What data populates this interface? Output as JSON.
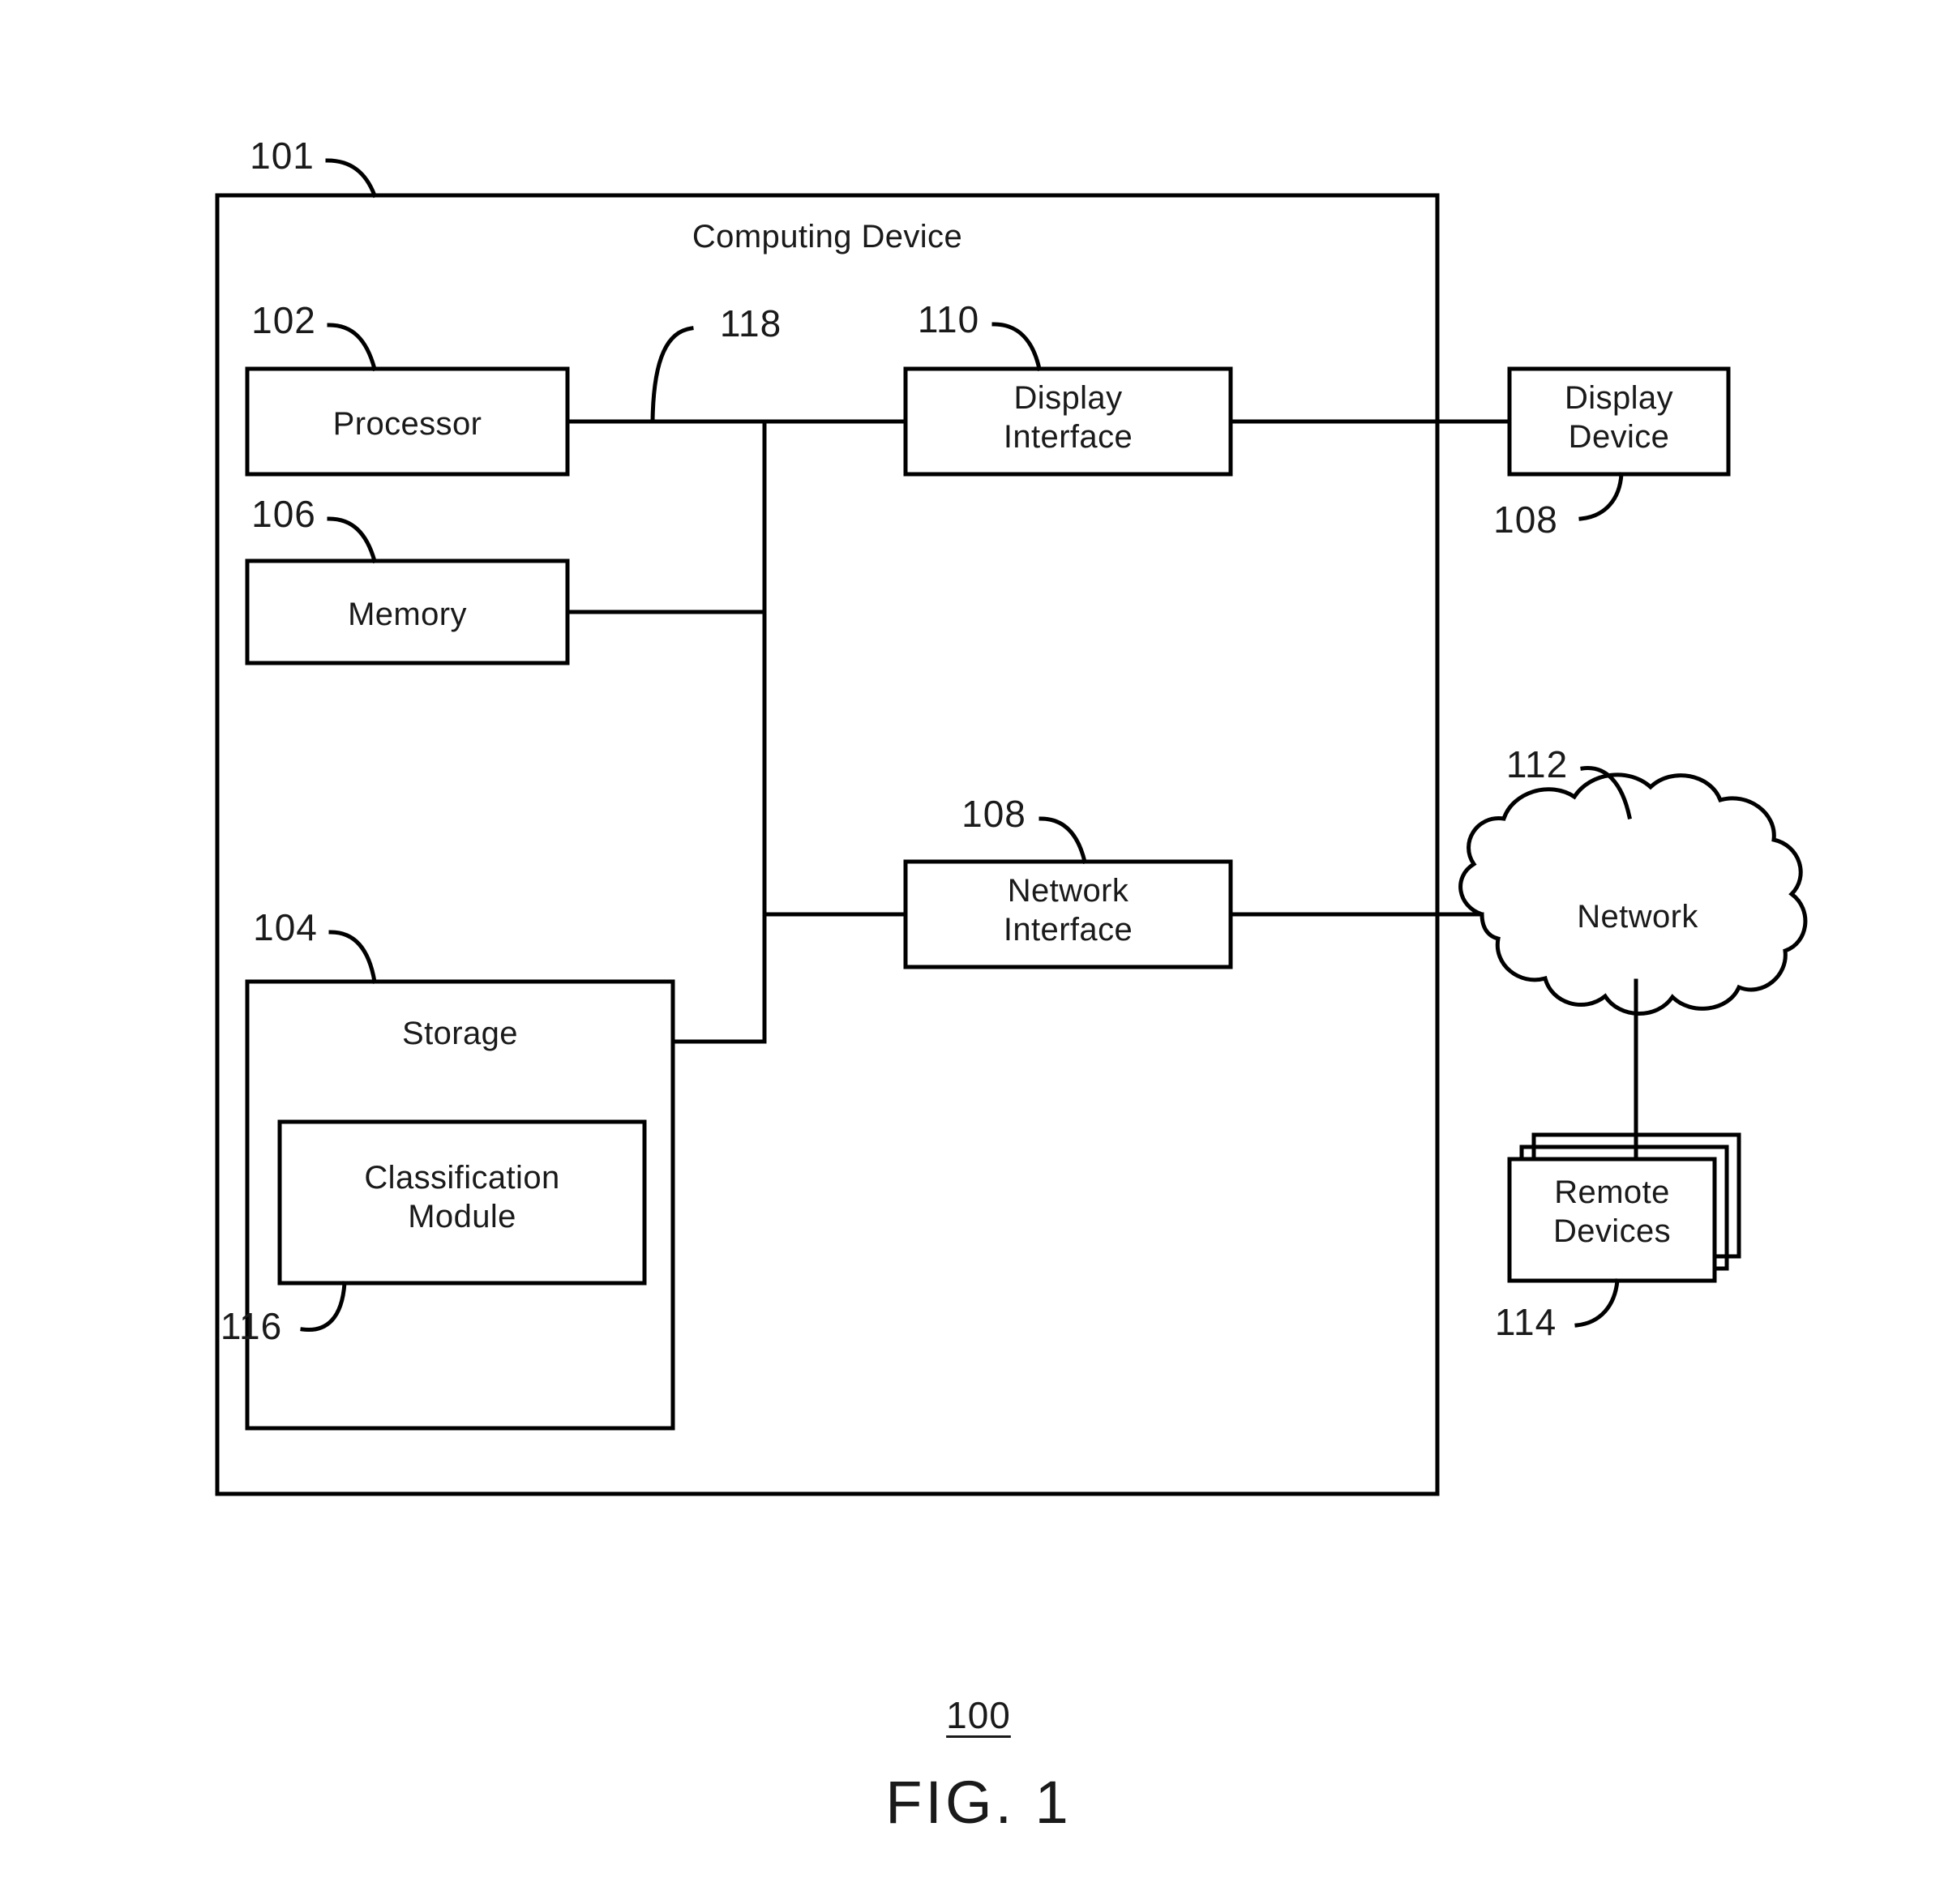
{
  "figure": {
    "caption_number": "100",
    "caption_label": "FIG. 1",
    "line_color": "#000000",
    "background_color": "#ffffff"
  },
  "diagram": {
    "title": "Computing Device",
    "title_ref": "101",
    "blocks": [
      {
        "id": "processor",
        "label": "Computing Device",
        "ref": "101"
      },
      {
        "id": "processor-block",
        "label": "Processor",
        "ref": "102"
      },
      {
        "id": "memory-block",
        "label": "Memory",
        "ref": "106"
      },
      {
        "id": "storage-block",
        "label": "Storage",
        "ref": "104"
      },
      {
        "id": "classification-block",
        "label_line1": "Classification",
        "label_line2": "Module",
        "ref": "116"
      },
      {
        "id": "display-interface",
        "label_line1": "Display",
        "label_line2": "Interface",
        "ref": "110"
      },
      {
        "id": "network-interface",
        "label_line1": "Network",
        "label_line2": "Interface",
        "ref": "108"
      },
      {
        "id": "display-device",
        "label_line1": "Display",
        "label_line2": "Device",
        "ref": "108"
      },
      {
        "id": "network-cloud",
        "label": "Network",
        "ref": "112"
      },
      {
        "id": "remote-devices",
        "label_line1": "Remote",
        "label_line2": "Devices",
        "ref": "114"
      }
    ],
    "bus": {
      "label": "118",
      "ref": "118"
    },
    "labels": {
      "computing_device": "Computing Device",
      "processor": "Processor",
      "memory": "Memory",
      "storage": "Storage",
      "classification_l1": "Classification",
      "classification_l2": "Module",
      "display_interface_l1": "Display",
      "display_interface_l2": "Interface",
      "network_interface_l1": "Network",
      "network_interface_l2": "Interface",
      "display_device_l1": "Display",
      "display_device_l2": "Device",
      "network": "Network",
      "remote_devices_l1": "Remote",
      "remote_devices_l2": "Devices"
    },
    "refs": {
      "computing_device": "101",
      "processor": "102",
      "bus": "118",
      "display_interface": "110",
      "display_device": "108",
      "memory": "106",
      "network_interface": "108",
      "network": "112",
      "storage": "104",
      "classification_module": "116",
      "remote_devices": "114"
    }
  }
}
